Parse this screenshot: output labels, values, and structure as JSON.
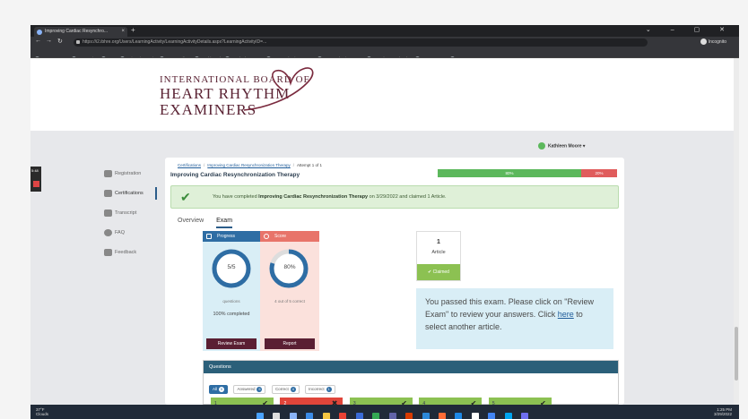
{
  "browser": {
    "tab_title": "Improving Cardiac Resynchro...",
    "tab_close": "×",
    "new_tab": "+",
    "url": "https://i2.ibhre.org/Users/LearningActivity/LearningActivityDetails.aspx?LearningActivityID=...",
    "incognito_label": "Incognito",
    "bookmarks": [
      "Home · Asana",
      "Demo Site",
      "ADA",
      "University Oasis",
      "PCI Sandbox",
      "Dashboard",
      "Zendesk Support",
      "PCI Production Cent...",
      "PCI Production Das...",
      "Youtube Download...",
      "IBHRE Demo",
      "HFSA ASM 2021 - ..."
    ]
  },
  "header": {
    "logo_line1": "INTERNATIONAL BOARD OF",
    "logo_line2": "HEART RHYTHM",
    "logo_line3": "EXAMINERS",
    "user_name": "Kathleen Moore"
  },
  "sidenav": {
    "items": [
      {
        "label": "Registration"
      },
      {
        "label": "Certifications"
      },
      {
        "label": "Transcript"
      },
      {
        "label": "FAQ"
      },
      {
        "label": "Feedback"
      }
    ]
  },
  "recorder": {
    "time": "5:48"
  },
  "content": {
    "breadcrumb": {
      "root": "Certifications",
      "activity": "Improving Cardiac Resynchronization Therapy",
      "current": "Attempt 1 of 1"
    },
    "title": "Improving Cardiac Resynchronization Therapy",
    "progress": {
      "pass_pct": 80,
      "fail_pct": 20,
      "pass_label": "80%",
      "fail_label": "20%"
    },
    "alert": {
      "prefix": "You have completed",
      "activity": "Improving Cardiac Resynchronization Therapy",
      "suffix": "on 3/29/2022 and claimed 1 Article."
    },
    "tabs": {
      "overview": "Overview",
      "exam": "Exam"
    },
    "progress_panel": {
      "title": "Progress",
      "ring_value": "5/5",
      "ring_fraction": 1.0,
      "sub": "questions",
      "completed": "100% completed",
      "button": "Review Exam"
    },
    "score_panel": {
      "title": "Score",
      "ring_value": "80%",
      "ring_fraction": 0.8,
      "sub": "4 out of 5 correct",
      "button": "Report"
    },
    "article": {
      "count": "1",
      "label": "Article",
      "status": "Claimed"
    },
    "pass_message": {
      "text_before": "You passed this exam. Please click on \"Review Exam\" to review your answers. Click",
      "link": "here",
      "text_after": "to select another article."
    },
    "questions": {
      "title": "Questions",
      "filters": [
        {
          "label": "All",
          "count": "5"
        },
        {
          "label": "Answered",
          "count": "5"
        },
        {
          "label": "Correct",
          "count": "4"
        },
        {
          "label": "Incorrect",
          "count": "1"
        }
      ],
      "items": [
        {
          "num": "1",
          "mark": "✔",
          "status": "correct"
        },
        {
          "num": "2",
          "mark": "✖",
          "status": "incorrect"
        },
        {
          "num": "3",
          "mark": "✔",
          "status": "correct"
        },
        {
          "num": "4",
          "mark": "✔",
          "status": "correct"
        },
        {
          "num": "5",
          "mark": "✔",
          "status": "correct"
        }
      ]
    }
  },
  "taskbar": {
    "weather_temp": "37°F",
    "weather_desc": "Clouds",
    "time": "1:25 PM",
    "date": "3/29/2022"
  },
  "colors": {
    "brand": "#5a2233",
    "accent_blue": "#2e6da4",
    "success": "#8cc152",
    "danger": "#e0453a"
  }
}
